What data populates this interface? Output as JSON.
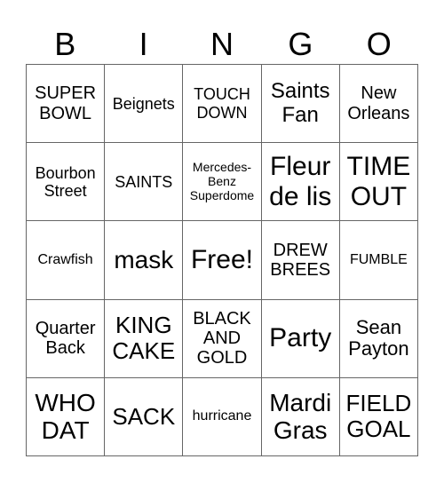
{
  "header": {
    "letters": [
      "B",
      "I",
      "N",
      "G",
      "O"
    ]
  },
  "card": {
    "rows": [
      [
        "SUPER\nBOWL",
        "Beignets",
        "TOUCH\nDOWN",
        "Saints\nFan",
        "New\nOrleans"
      ],
      [
        "Bourbon\nStreet",
        "SAINTS",
        "Mercedes-\nBenz\nSuperdome",
        "Fleur\nde lis",
        "TIME\nOUT"
      ],
      [
        "Crawfish",
        "mask",
        "Free!",
        "DREW\nBREES",
        "FUMBLE"
      ],
      [
        "Quarter\nBack",
        "KING\nCAKE",
        "BLACK\nAND\nGOLD",
        "Party",
        "Sean\nPayton"
      ],
      [
        "WHO\nDAT",
        "SACK",
        "hurricane",
        "Mardi\nGras",
        "FIELD\nGOAL"
      ]
    ]
  }
}
